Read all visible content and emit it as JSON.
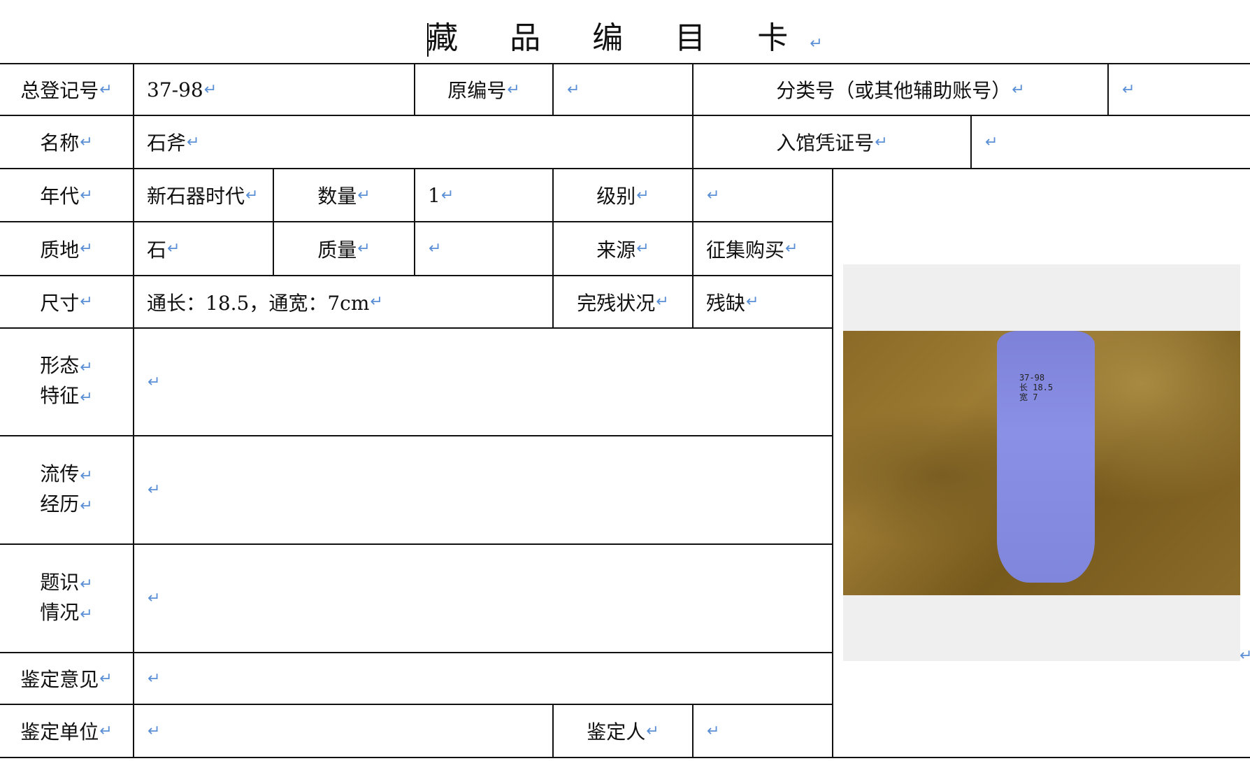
{
  "title": "藏 品 编 目 卡",
  "return_mark": "↵",
  "labels": {
    "total_reg_no": "总登记号",
    "original_no": "原编号",
    "category_no": "分类号（或其他辅助账号）",
    "name": "名称",
    "entry_voucher_no": "入馆凭证号",
    "era": "年代",
    "quantity": "数量",
    "grade": "级别",
    "material": "质地",
    "weight": "质量",
    "source": "来源",
    "size": "尺寸",
    "condition": "完残状况",
    "form_l1": "形态",
    "form_l2": "特征",
    "history_l1": "流传",
    "history_l2": "经历",
    "inscription_l1": "题识",
    "inscription_l2": "情况",
    "appraisal_opinion": "鉴定意见",
    "appraisal_unit": "鉴定单位",
    "appraiser": "鉴定人"
  },
  "values": {
    "total_reg_no": "37-98",
    "original_no": "",
    "category_no": "",
    "name": "石斧",
    "entry_voucher_no": "",
    "era": "新石器时代",
    "quantity": "1",
    "grade": "",
    "material": "石",
    "weight": "",
    "source": "征集购买",
    "size": "通长：18.5，通宽：7cm",
    "condition": "残缺",
    "form": "",
    "history": "",
    "inscription": "",
    "appraisal_opinion": "",
    "appraisal_unit": "",
    "appraiser": ""
  },
  "photo": {
    "note_l1": "37-98",
    "note_l2": "长 18.5",
    "note_l3": "宽 7"
  }
}
